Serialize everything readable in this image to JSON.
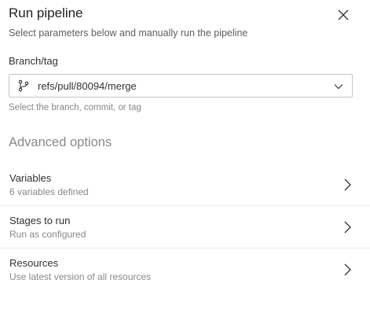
{
  "dialog": {
    "title": "Run pipeline",
    "subtitle": "Select parameters below and manually run the pipeline"
  },
  "branch": {
    "label": "Branch/tag",
    "value": "refs/pull/80094/merge",
    "helper": "Select the branch, commit, or tag"
  },
  "advanced": {
    "heading": "Advanced options",
    "items": [
      {
        "title": "Variables",
        "subtitle": "6 variables defined"
      },
      {
        "title": "Stages to run",
        "subtitle": "Run as configured"
      },
      {
        "title": "Resources",
        "subtitle": "Use latest version of all resources"
      }
    ]
  },
  "icons": {
    "close": "close-icon",
    "branch": "branch-icon",
    "dropdown": "chevron-down-icon",
    "row_chevron": "chevron-right-icon"
  },
  "colors": {
    "text": "#201f1e",
    "muted": "#8a8886",
    "border": "#c8c6c4",
    "divider": "#edebe9"
  }
}
